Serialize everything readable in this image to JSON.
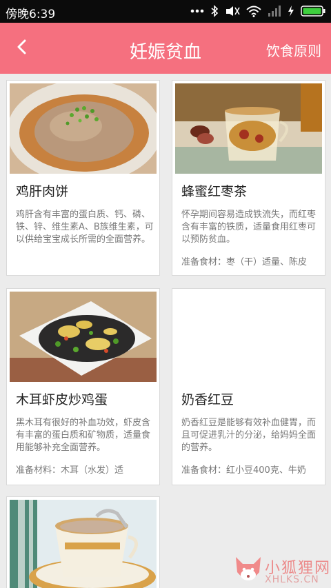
{
  "status_bar": {
    "time": "傍晚6:39",
    "icons": [
      "more-dots-icon",
      "bluetooth-icon",
      "mute-icon",
      "wifi-icon",
      "signal-icon",
      "charging-icon",
      "battery-icon"
    ]
  },
  "header": {
    "title": "妊娠贫血",
    "action_label": "饮食原则",
    "back_icon": "chevron-left-icon",
    "background_color": "#f5707f"
  },
  "recipes": [
    {
      "title": "鸡肝肉饼",
      "description": "鸡肝含有丰富的蛋白质、钙、磷、铁、锌、维生素A、B族维生素，可以供给宝宝成长所需的全面营养。",
      "ingredients": ""
    },
    {
      "title": "蜂蜜红枣茶",
      "description": "怀孕期间容易造成铁流失，而红枣含有丰富的铁质，适量食用红枣可以预防贫血。",
      "ingredients": "准备食材：枣（干）适量、陈皮"
    },
    {
      "title": "木耳虾皮炒鸡蛋",
      "description": "黑木耳有很好的补血功效，虾皮含有丰富的蛋白质和矿物质，适量食用能够补充全面营养。",
      "ingredients": "准备材料：木耳（水发）适"
    },
    {
      "title": "奶香红豆",
      "description": "奶香红豆是能够有效补血健胃，而且可促进乳汁的分泌，给妈妈全面的营养。",
      "ingredients": "准备食材：红小豆400克、牛奶"
    },
    {
      "title": "",
      "description": "",
      "ingredients": ""
    }
  ],
  "watermark": {
    "text": "小狐狸网",
    "domain": "XHLKS.CN"
  }
}
